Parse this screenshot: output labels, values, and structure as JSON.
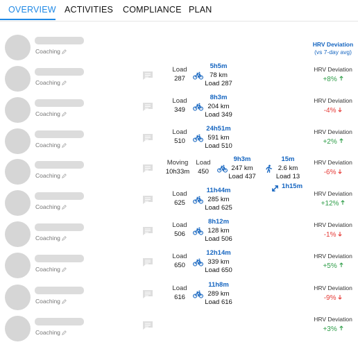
{
  "tabs": [
    {
      "label": "OVERVIEW",
      "active": true
    },
    {
      "label": "ACTIVITIES",
      "active": false
    },
    {
      "label": "COMPLIANCE",
      "active": false
    },
    {
      "label": "PLAN",
      "active": false
    }
  ],
  "hrv_header": {
    "title": "HRV Deviation",
    "subtitle": "(vs 7-day avg)"
  },
  "rows": [
    {
      "coaching": "Coaching",
      "hrv": null
    },
    {
      "coaching": "Coaching",
      "load_label": "Load",
      "load": "287",
      "bike": {
        "time": "5h5m",
        "dist": "78 km",
        "load": "Load 287"
      },
      "hrv": {
        "label": "HRV Deviation",
        "value": "+8%",
        "dir": "up",
        "color": "#2e9d48"
      }
    },
    {
      "coaching": "Coaching",
      "load_label": "Load",
      "load": "349",
      "bike": {
        "time": "8h3m",
        "dist": "204 km",
        "load": "Load 349"
      },
      "hrv": {
        "label": "HRV Deviation",
        "value": "-4%",
        "dir": "down",
        "color": "#e53935"
      }
    },
    {
      "coaching": "Coaching",
      "load_label": "Load",
      "load": "510",
      "bike": {
        "time": "24h51m",
        "dist": "591 km",
        "load": "Load 510"
      },
      "hrv": {
        "label": "HRV Deviation",
        "value": "+2%",
        "dir": "up",
        "color": "#2e9d48"
      }
    },
    {
      "coaching": "Coaching",
      "moving_label": "Moving",
      "moving": "10h33m",
      "load_label": "Load",
      "load": "450",
      "bike": {
        "time": "9h3m",
        "dist": "247 km",
        "load": "Load 437"
      },
      "run": {
        "time": "15m",
        "dist": "2.6 km",
        "load": "Load 13"
      },
      "other": {
        "time": "1h15m"
      },
      "hrv": {
        "label": "HRV Deviation",
        "value": "-6%",
        "dir": "down",
        "color": "#e53935"
      }
    },
    {
      "coaching": "Coaching",
      "load_label": "Load",
      "load": "625",
      "bike": {
        "time": "11h44m",
        "dist": "285 km",
        "load": "Load 625"
      },
      "hrv": {
        "label": "HRV Deviation",
        "value": "+12%",
        "dir": "up",
        "color": "#2e9d48"
      }
    },
    {
      "coaching": "Coaching",
      "load_label": "Load",
      "load": "506",
      "bike": {
        "time": "8h12m",
        "dist": "128 km",
        "load": "Load 506"
      },
      "hrv": {
        "label": "HRV Deviation",
        "value": "-1%",
        "dir": "down",
        "color": "#e53935"
      }
    },
    {
      "coaching": "Coaching",
      "load_label": "Load",
      "load": "650",
      "bike": {
        "time": "12h14m",
        "dist": "339 km",
        "load": "Load 650"
      },
      "hrv": {
        "label": "HRV Deviation",
        "value": "+5%",
        "dir": "up",
        "color": "#2e9d48"
      }
    },
    {
      "coaching": "Coaching",
      "load_label": "Load",
      "load": "616",
      "bike": {
        "time": "11h8m",
        "dist": "289 km",
        "load": "Load 616"
      },
      "hrv": {
        "label": "HRV Deviation",
        "value": "-9%",
        "dir": "down",
        "color": "#e53935"
      }
    },
    {
      "coaching": "Coaching",
      "hrv": {
        "label": "HRV Deviation",
        "value": "+3%",
        "dir": "up",
        "color": "#2e9d48"
      }
    }
  ],
  "icons": {
    "bike": "bike-icon",
    "run": "run-icon",
    "other": "double-arrow-icon",
    "comment": "comment-icon",
    "edit": "pencil-icon",
    "trend_up": "arrow-up-icon",
    "trend_down": "arrow-down-icon"
  },
  "colors": {
    "accent": "#1e88e5",
    "link": "#1565c0",
    "positive": "#2e9d48",
    "negative": "#e53935"
  }
}
